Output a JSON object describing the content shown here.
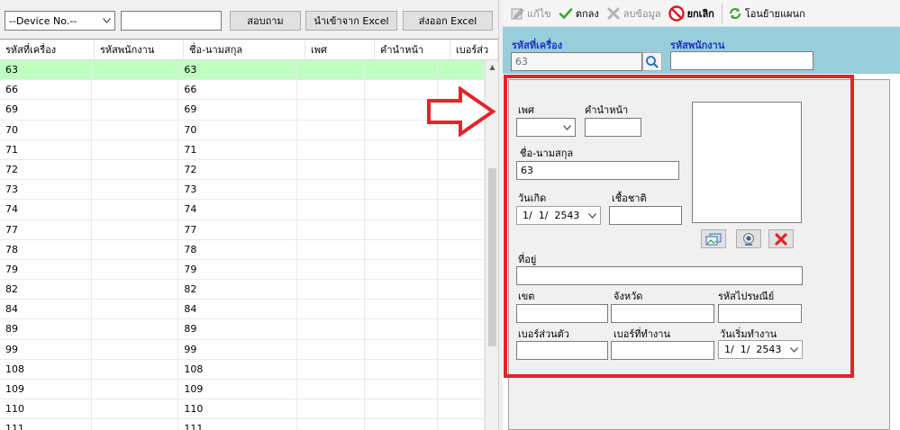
{
  "top_toolbar": {
    "device_select": "--Device No.--",
    "search_value": "",
    "search_button": "สอบถาม",
    "import_button": "นำเข้าจาก Excel",
    "export_button": "ส่งออก Excel"
  },
  "grid": {
    "columns": [
      "รหัสที่เครื่อง",
      "รหัสพนักงาน",
      "ชื่อ-นามสกุล",
      "เพศ",
      "คำนำหน้า",
      "เบอร์ส่ว"
    ],
    "rows": [
      [
        "63",
        "",
        "63",
        "",
        "",
        ""
      ],
      [
        "66",
        "",
        "66",
        "",
        "",
        ""
      ],
      [
        "69",
        "",
        "69",
        "",
        "",
        ""
      ],
      [
        "70",
        "",
        "70",
        "",
        "",
        ""
      ],
      [
        "71",
        "",
        "71",
        "",
        "",
        ""
      ],
      [
        "72",
        "",
        "72",
        "",
        "",
        ""
      ],
      [
        "73",
        "",
        "73",
        "",
        "",
        ""
      ],
      [
        "74",
        "",
        "74",
        "",
        "",
        ""
      ],
      [
        "77",
        "",
        "77",
        "",
        "",
        ""
      ],
      [
        "78",
        "",
        "78",
        "",
        "",
        ""
      ],
      [
        "79",
        "",
        "79",
        "",
        "",
        ""
      ],
      [
        "82",
        "",
        "82",
        "",
        "",
        ""
      ],
      [
        "84",
        "",
        "84",
        "",
        "",
        ""
      ],
      [
        "89",
        "",
        "89",
        "",
        "",
        ""
      ],
      [
        "99",
        "",
        "99",
        "",
        "",
        ""
      ],
      [
        "108",
        "",
        "108",
        "",
        "",
        ""
      ],
      [
        "109",
        "",
        "109",
        "",
        "",
        ""
      ],
      [
        "110",
        "",
        "110",
        "",
        "",
        ""
      ],
      [
        "111",
        "",
        "111",
        "",
        "",
        ""
      ]
    ],
    "selected_row": 0
  },
  "right_toolbar": {
    "edit": "แก้ไข",
    "ok": "ตกลง",
    "delete": "ลบข้อมูล",
    "cancel": "ยกเลิก",
    "transfer": "โอนย้ายแผนก"
  },
  "header_fields": {
    "machine_id_label": "รหัสที่เครื่อง",
    "machine_id_value": "63",
    "employee_id_label": "รหัสพนักงาน",
    "employee_id_value": ""
  },
  "form": {
    "gender_label": "เพศ",
    "gender_value": "",
    "title_label": "คำนำหน้า",
    "title_value": "",
    "fullname_label": "ชื่อ-นามสกุล",
    "fullname_value": "63",
    "birthdate_label": "วันเกิด",
    "birthdate_value": "1/  1/  2543",
    "nationality_label": "เชื้อชาติ",
    "nationality_value": "",
    "address_label": "ที่อยู่",
    "address_value": "",
    "district_label": "เขต",
    "district_value": "",
    "province_label": "จังหวัด",
    "province_value": "",
    "postal_label": "รหัสไปรษณีย์",
    "postal_value": "",
    "mobile_label": "เบอร์ส่วนตัว",
    "mobile_value": "",
    "work_phone_label": "เบอร์ที่ทำงาน",
    "work_phone_value": "",
    "start_date_label": "วันเริ่มทำงาน",
    "start_date_value": "1/  1/  2543"
  },
  "colors": {
    "selected_row": "#c1ffc1",
    "banner": "#98cedb",
    "highlight": "#e3242b",
    "label_blue": "#1a35c4"
  }
}
